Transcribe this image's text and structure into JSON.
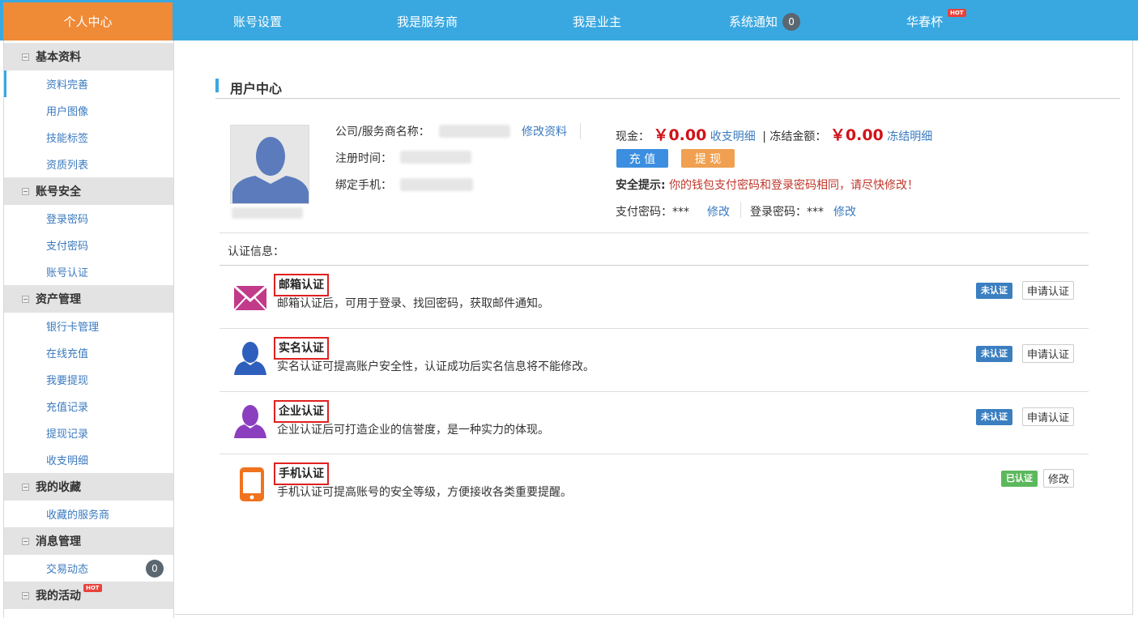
{
  "nav": {
    "home": "个人中心",
    "items": [
      "账号设置",
      "我是服务商",
      "我是业主",
      "系统通知",
      "华春杯"
    ],
    "notify_count": "0",
    "hot": "HOT"
  },
  "sidebar": {
    "groups": [
      {
        "title": "基本资料",
        "items": [
          "资料完善",
          "用户图像",
          "技能标签",
          "资质列表"
        ]
      },
      {
        "title": "账号安全",
        "items": [
          "登录密码",
          "支付密码",
          "账号认证"
        ]
      },
      {
        "title": "资产管理",
        "items": [
          "银行卡管理",
          "在线充值",
          "我要提现",
          "充值记录",
          "提现记录",
          "收支明细"
        ]
      },
      {
        "title": "我的收藏",
        "items": [
          "收藏的服务商"
        ]
      },
      {
        "title": "消息管理",
        "items": [
          "交易动态"
        ]
      },
      {
        "title": "我的活动",
        "items": []
      }
    ],
    "message_count": "0"
  },
  "page": {
    "title": "用户中心",
    "company_label": "公司/服务商名称：",
    "edit_profile": "修改资料",
    "reg_time_label": "注册时间：",
    "phone_label": "绑定手机：",
    "cash_label": "现金：",
    "cash_value": "￥0.00",
    "cash_detail": "收支明细",
    "frozen_label": "| 冻结金额：",
    "frozen_value": "￥0.00",
    "frozen_detail": "冻结明细",
    "recharge": "充 值",
    "withdraw": "提 现",
    "tip_label": "安全提示:",
    "tip_text": "你的钱包支付密码和登录密码相同，请尽快修改！",
    "pay_pwd": "支付密码：***",
    "pay_pwd_edit": "修改",
    "login_pwd": "登录密码：***",
    "login_pwd_edit": "修改",
    "cert_header": "认证信息："
  },
  "certs": [
    {
      "title": "邮箱认证",
      "desc": "邮箱认证后，可用于登录、找回密码，获取邮件通知。",
      "status": "未认证",
      "action": "申请认证",
      "icon": "mail-icon"
    },
    {
      "title": "实名认证",
      "desc": "实名认证可提高账户安全性，认证成功后实名信息将不能修改。",
      "status": "未认证",
      "action": "申请认证",
      "icon": "person-icon"
    },
    {
      "title": "企业认证",
      "desc": "企业认证后可打造企业的信誉度，是一种实力的体现。",
      "status": "未认证",
      "action": "申请认证",
      "icon": "enterprise-icon"
    },
    {
      "title": "手机认证",
      "desc": "手机认证可提高账号的安全等级，方便接收各类重要提醒。",
      "status": "已认证",
      "action": "修改",
      "icon": "phone-icon"
    }
  ],
  "colors": {
    "nav": "#3aa8e0",
    "home": "#ef8a37",
    "unverified": "#3b7fc0",
    "verified": "#5cb85c",
    "money": "#d0131a"
  }
}
